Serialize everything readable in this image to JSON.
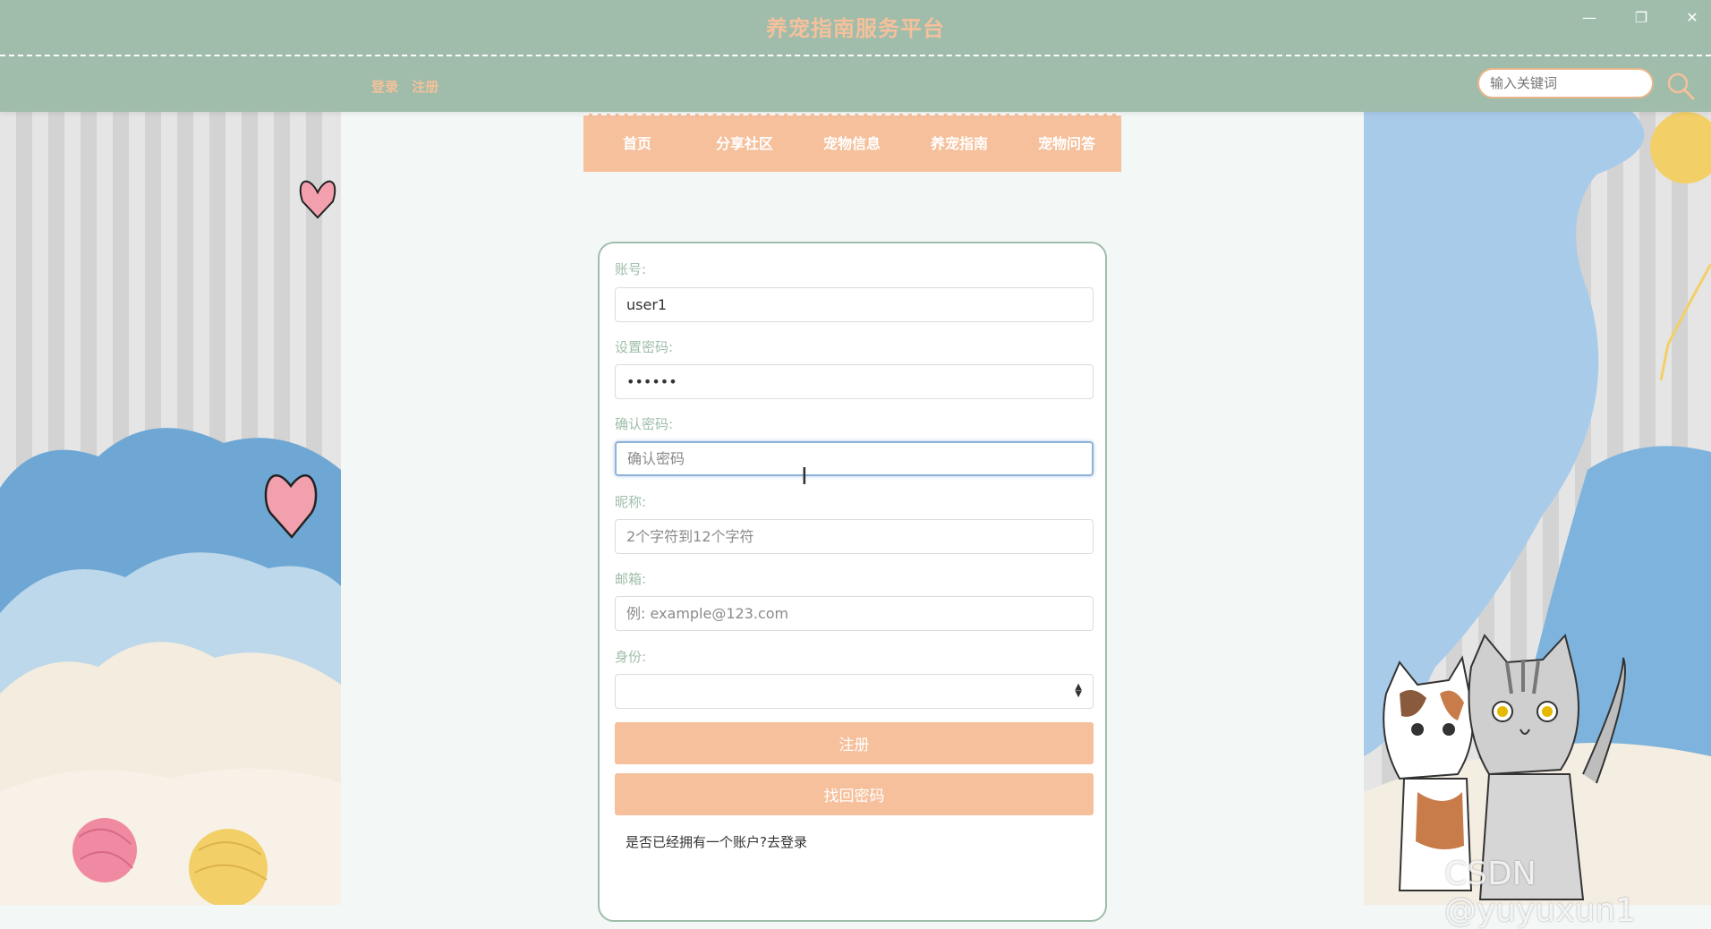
{
  "header": {
    "site_title": "养宠指南服务平台",
    "login_link": "登录",
    "register_link": "注册",
    "search_placeholder": "输入关键词"
  },
  "window_controls": {
    "minimize": "—",
    "restore": "❐",
    "close": "✕"
  },
  "nav": {
    "items": [
      "首页",
      "分享社区",
      "宠物信息",
      "养宠指南",
      "宠物问答"
    ]
  },
  "form": {
    "account_label": "账号:",
    "account_value": "user1",
    "password_label": "设置密码:",
    "password_value": "••••••",
    "confirm_label": "确认密码:",
    "confirm_placeholder": "确认密码",
    "nickname_label": "昵称:",
    "nickname_placeholder": "2个字符到12个字符",
    "email_label": "邮箱:",
    "email_placeholder": "例: example@123.com",
    "identity_label": "身份:",
    "identity_value": "",
    "register_button": "注册",
    "recover_button": "找回密码",
    "login_prompt": "是否已经拥有一个账户?去登录"
  },
  "watermark": "CSDN @yuyuxun1",
  "colors": {
    "header_bg": "#9fbdaa",
    "accent_peach": "#f5c09b",
    "page_bg": "#f3f8f7",
    "label_green": "#9fbdaa"
  },
  "icons": [
    "search-icon",
    "text-cursor-icon",
    "minimize-icon",
    "restore-icon",
    "close-icon"
  ]
}
